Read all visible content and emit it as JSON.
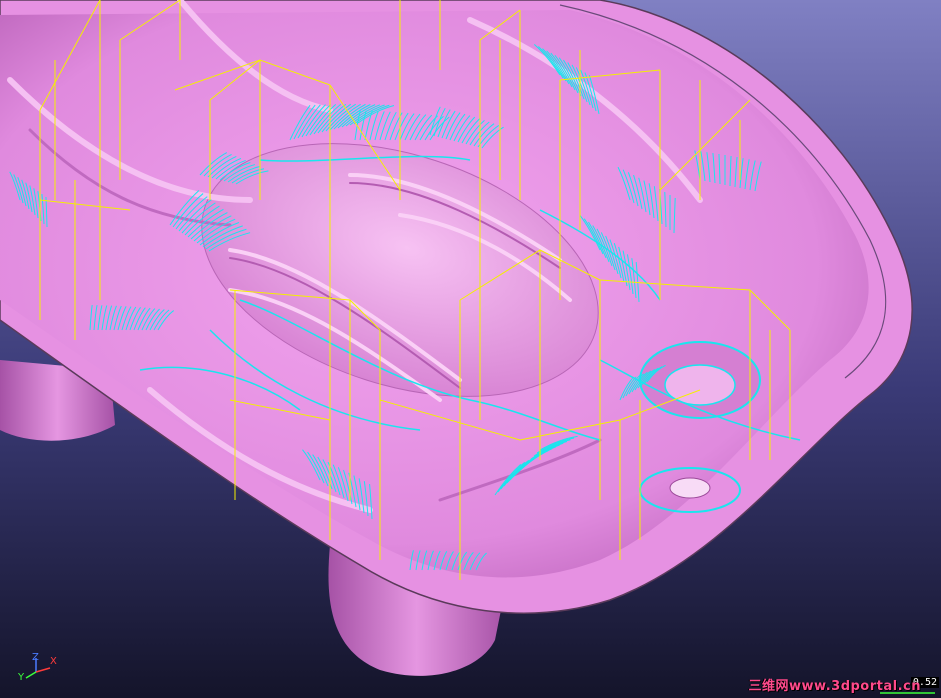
{
  "viewport": {
    "name": "3D toolpath viewport",
    "colors": {
      "background_top": "#7f7fc2",
      "background_bottom": "#15152a",
      "part": "#e98ee6",
      "part_shadow": "#b55cb6",
      "part_highlight": "#fbd3f8",
      "toolpath_cut": "#19e6ee",
      "toolpath_rapid": "#f4f000",
      "axis_x": "#ff3b3b",
      "axis_y": "#3bff3b",
      "axis_z": "#4a7bff"
    }
  },
  "axis_triad": {
    "z_label": "Z",
    "x_label": "X",
    "y_label": "Y"
  },
  "scale_readout": "0.52",
  "watermark": {
    "text": "三维网www.3dportal.cn",
    "color": "#ff4a8c"
  }
}
